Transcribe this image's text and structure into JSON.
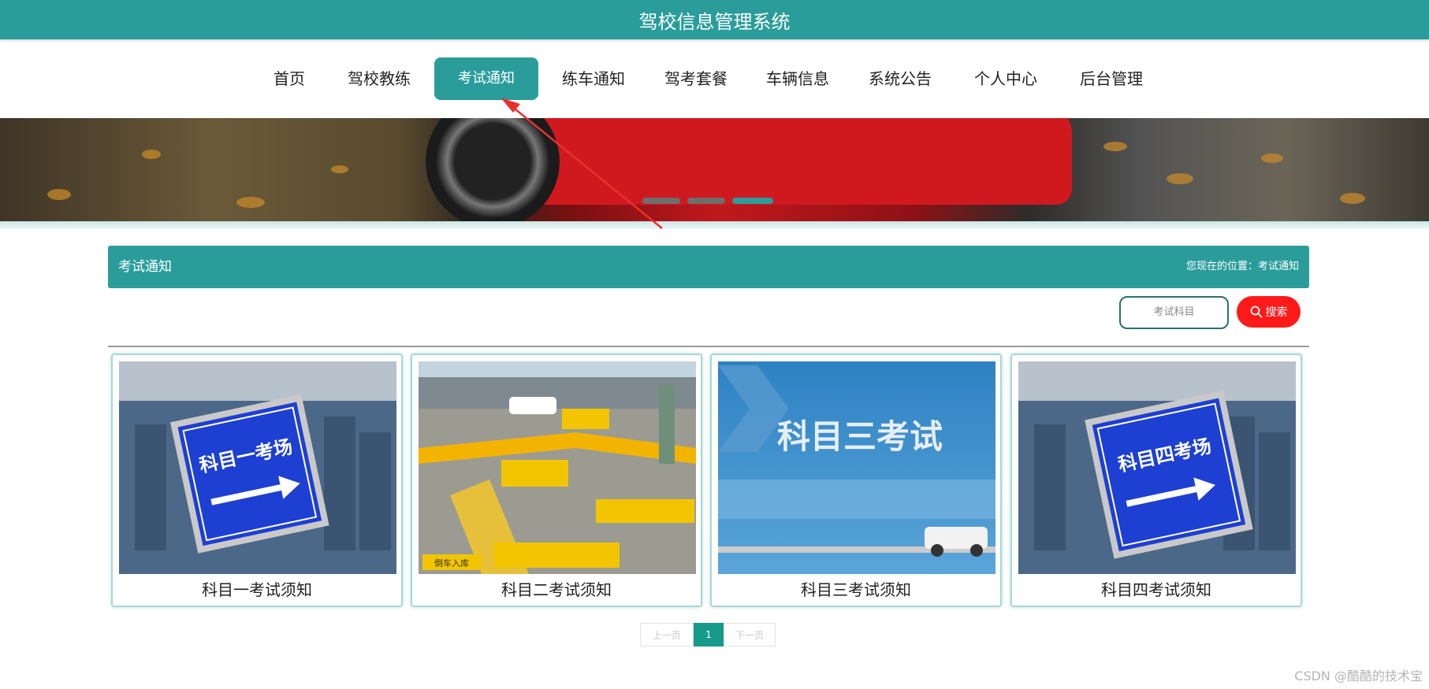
{
  "header": {
    "title": "驾校信息管理系统"
  },
  "nav": {
    "items": [
      {
        "label": "首页"
      },
      {
        "label": "驾校教练"
      },
      {
        "label": "考试通知"
      },
      {
        "label": "练车通知"
      },
      {
        "label": "驾考套餐"
      },
      {
        "label": "车辆信息"
      },
      {
        "label": "系统公告"
      },
      {
        "label": "个人中心"
      },
      {
        "label": "后台管理"
      }
    ],
    "active_index": 2
  },
  "section": {
    "title": "考试通知",
    "breadcrumb": "您现在的位置：考试通知"
  },
  "search": {
    "placeholder": "考试科目",
    "button_label": "搜索"
  },
  "cards": [
    {
      "caption": "科目一考试须知",
      "sign_text": "科目一考场"
    },
    {
      "caption": "科目二考试须知",
      "sign_text": "倒车入库"
    },
    {
      "caption": "科目三考试须知",
      "sign_text": "科目三考试"
    },
    {
      "caption": "科目四考试须知",
      "sign_text": "科目四考场"
    }
  ],
  "pager": {
    "prev_label": "上一页",
    "current": "1",
    "next_label": "下一页"
  },
  "watermark": "CSDN @酷酷的技术宝",
  "colors": {
    "primary": "#2a9d9b",
    "search_button": "#ff1a1a",
    "annotation_arrow": "#e8312f"
  }
}
